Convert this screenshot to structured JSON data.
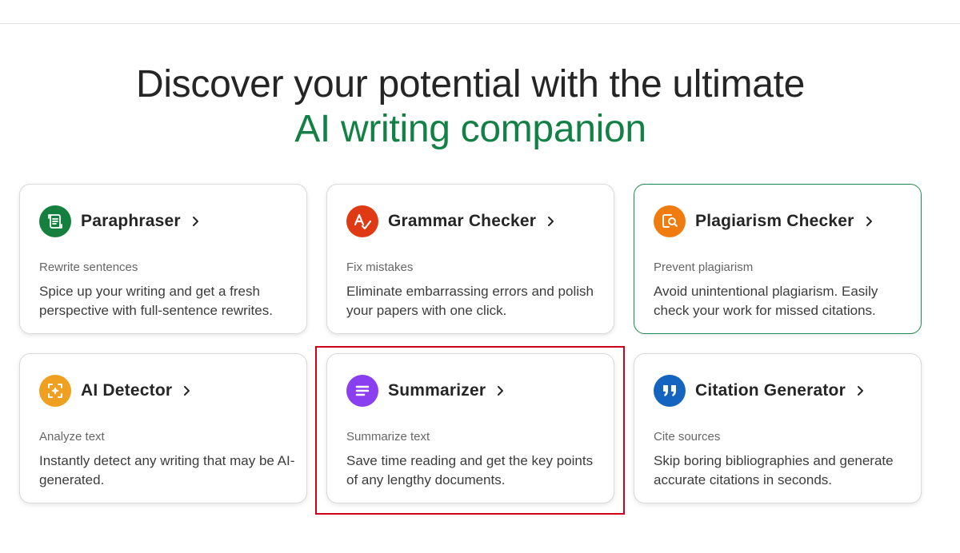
{
  "hero": {
    "line1": "Discover your potential with the ultimate",
    "line2": "AI writing companion"
  },
  "colors": {
    "accent": "#138145",
    "highlight_box": "#d0021b"
  },
  "cards": [
    {
      "title": "Paraphraser",
      "subtitle": "Rewrite sentences",
      "description": "Spice up your writing and get a fresh perspective with full-sentence rewrites.",
      "icon": "paraphraser-icon",
      "icon_color": "#15803d"
    },
    {
      "title": "Grammar Checker",
      "subtitle": "Fix mistakes",
      "description": "Eliminate embarrassing errors and polish your papers with one click.",
      "icon": "grammar-check-icon",
      "icon_color": "#e03a14"
    },
    {
      "title": "Plagiarism Checker",
      "subtitle": "Prevent plagiarism",
      "description": "Avoid unintentional plagiarism. Easily check your work for missed citations.",
      "icon": "plagiarism-search-icon",
      "icon_color": "#f07c10"
    },
    {
      "title": "AI Detector",
      "subtitle": "Analyze text",
      "description": "Instantly detect any writing that may be AI-generated.",
      "icon": "ai-detector-icon",
      "icon_color": "#f0a020"
    },
    {
      "title": "Summarizer",
      "subtitle": "Summarize text",
      "description": "Save time reading and get the key points of any lengthy documents.",
      "icon": "summarizer-lines-icon",
      "icon_color": "#8a3ff0"
    },
    {
      "title": "Citation Generator",
      "subtitle": "Cite sources",
      "description": "Skip boring bibliographies and generate accurate citations in seconds.",
      "icon": "quote-marks-icon",
      "icon_color": "#1565c0"
    }
  ]
}
